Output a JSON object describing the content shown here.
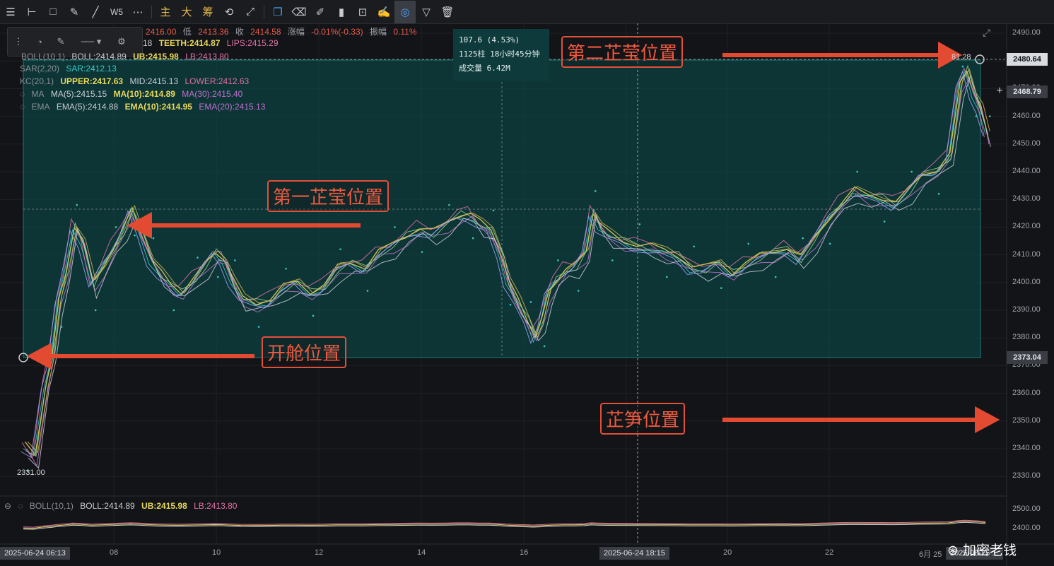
{
  "toolbar": {
    "icons": [
      "menu-icon",
      "horizontal-line-icon",
      "rectangle-icon",
      "ruler-icon",
      "trend-line-icon",
      "wave-icon",
      "more-icon"
    ],
    "indicator_labels": [
      "主",
      "大",
      "筹"
    ],
    "wave_label": "W5"
  },
  "ohlc": {
    "high_value": "2416.00",
    "low_label": "低",
    "low_value": "2413.36",
    "close_label": "收",
    "close_value": "2414.58",
    "change_label": "涨幅",
    "change_value": "-0.01%(-0.33)",
    "amp_label": "振幅",
    "amp_value": "0.11%",
    "alligator_prefix": "18",
    "teeth": "TEETH:2414.87",
    "lips": "LIPS:2415.29"
  },
  "indicators": {
    "boll_top": {
      "name": "BOLL(10,1)",
      "boll": "BOLL:2414.89",
      "ub": "UB:2415.98",
      "lb": "LB:2413.80"
    },
    "sar": {
      "name": "SAR(2,20)",
      "value": "SAR:2412.13"
    },
    "kc": {
      "name": "KC(20,1)",
      "upper": "UPPER:2417.63",
      "mid": "MID:2415.13",
      "lower": "LOWER:2412.63"
    },
    "ma": {
      "name": "MA",
      "ma5": "MA(5):2415.15",
      "ma10": "MA(10):2414.89",
      "ma30": "MA(30):2415.40"
    },
    "ema": {
      "name": "EMA",
      "ema5": "EMA(5):2414.88",
      "ema10": "EMA(10):2414.95",
      "ema20": "EMA(20):2415.13"
    },
    "boll_bottom": {
      "name": "BOLL(10,1)",
      "boll": "BOLL:2414.89",
      "ub": "UB:2415.98",
      "lb": "LB:2413.80"
    }
  },
  "info_box": {
    "line1": "107.6 (4.53%)",
    "line2": "1125柱 18小时45分钟",
    "line3": "成交量 6.42M"
  },
  "annotations": {
    "second_peak": "第二芷莹位置",
    "first_peak": "第一芷莹位置",
    "open_position": "开舱位置",
    "bottom_position": "芷笋位置"
  },
  "chart_data": {
    "type": "line",
    "title": "",
    "ylim": [
      2325,
      2492
    ],
    "y_ticks": [
      "2490.00",
      "2480.00",
      "2470.00",
      "2460.00",
      "2450.00",
      "2440.00",
      "2430.00",
      "2420.00",
      "2410.00",
      "2400.00",
      "2390.00",
      "2380.00",
      "2370.00",
      "2360.00",
      "2350.00",
      "2340.00",
      "2330.00"
    ],
    "x_ticks": [
      "08",
      "10",
      "12",
      "14",
      "16",
      "18",
      "20",
      "22"
    ],
    "price_tags": {
      "top": "2480.64",
      "cross": "2468.79",
      "box_low": "2373.04"
    },
    "low_marker": "2331.00",
    "high_marker": "81.28",
    "time_tags": {
      "left": "2025-06-24 06:13",
      "cross": "2025-06-24 18:15",
      "right": "2025-06-25 ..."
    },
    "right_month_label": "6月 25",
    "sub_ticks": [
      "2500.00",
      "2400.00"
    ],
    "price_series": [
      [
        0,
        2340
      ],
      [
        0.3,
        2336
      ],
      [
        0.6,
        2362
      ],
      [
        0.8,
        2373
      ],
      [
        1.0,
        2392
      ],
      [
        1.2,
        2402
      ],
      [
        1.45,
        2420
      ],
      [
        1.7,
        2414
      ],
      [
        2.0,
        2398
      ],
      [
        2.3,
        2405
      ],
      [
        2.6,
        2412
      ],
      [
        2.9,
        2418
      ],
      [
        3.15,
        2425
      ],
      [
        3.4,
        2418
      ],
      [
        3.7,
        2408
      ],
      [
        4.0,
        2402
      ],
      [
        4.3,
        2398
      ],
      [
        4.6,
        2396
      ],
      [
        5.0,
        2401
      ],
      [
        5.3,
        2405
      ],
      [
        5.6,
        2410
      ],
      [
        5.85,
        2408
      ],
      [
        6.1,
        2400
      ],
      [
        6.4,
        2393
      ],
      [
        6.8,
        2392
      ],
      [
        7.2,
        2393
      ],
      [
        7.6,
        2397
      ],
      [
        8.0,
        2399
      ],
      [
        8.4,
        2396
      ],
      [
        8.8,
        2398
      ],
      [
        9.2,
        2404
      ],
      [
        9.6,
        2406
      ],
      [
        10.0,
        2405
      ],
      [
        10.4,
        2410
      ],
      [
        10.8,
        2412
      ],
      [
        11.2,
        2416
      ],
      [
        11.6,
        2419
      ],
      [
        12.0,
        2417
      ],
      [
        12.4,
        2420
      ],
      [
        12.8,
        2424
      ],
      [
        13.1,
        2424
      ],
      [
        13.4,
        2420
      ],
      [
        13.7,
        2418
      ],
      [
        14.0,
        2410
      ],
      [
        14.2,
        2400
      ],
      [
        14.5,
        2392
      ],
      [
        14.8,
        2385
      ],
      [
        15.0,
        2380
      ],
      [
        15.2,
        2385
      ],
      [
        15.4,
        2395
      ],
      [
        15.6,
        2400
      ],
      [
        15.9,
        2404
      ],
      [
        16.2,
        2405
      ],
      [
        16.5,
        2410
      ],
      [
        16.7,
        2425
      ],
      [
        16.9,
        2420
      ],
      [
        17.2,
        2416
      ],
      [
        17.6,
        2414
      ],
      [
        18.0,
        2413
      ],
      [
        18.4,
        2412
      ],
      [
        18.8,
        2410
      ],
      [
        19.2,
        2409
      ],
      [
        19.6,
        2405
      ],
      [
        20.0,
        2404
      ],
      [
        20.4,
        2406
      ],
      [
        20.8,
        2403
      ],
      [
        21.2,
        2406
      ],
      [
        21.6,
        2408
      ],
      [
        22.0,
        2410
      ],
      [
        22.4,
        2412
      ],
      [
        22.8,
        2408
      ],
      [
        23.2,
        2414
      ],
      [
        23.6,
        2422
      ],
      [
        24.0,
        2428
      ],
      [
        24.4,
        2432
      ],
      [
        24.8,
        2430
      ],
      [
        25.2,
        2430
      ],
      [
        25.6,
        2428
      ],
      [
        26.0,
        2432
      ],
      [
        26.4,
        2438
      ],
      [
        26.8,
        2440
      ],
      [
        27.2,
        2445
      ],
      [
        27.5,
        2470
      ],
      [
        27.7,
        2476
      ],
      [
        27.9,
        2468
      ],
      [
        28.1,
        2462
      ],
      [
        28.3,
        2452
      ]
    ]
  },
  "watermark": "加密老钱"
}
